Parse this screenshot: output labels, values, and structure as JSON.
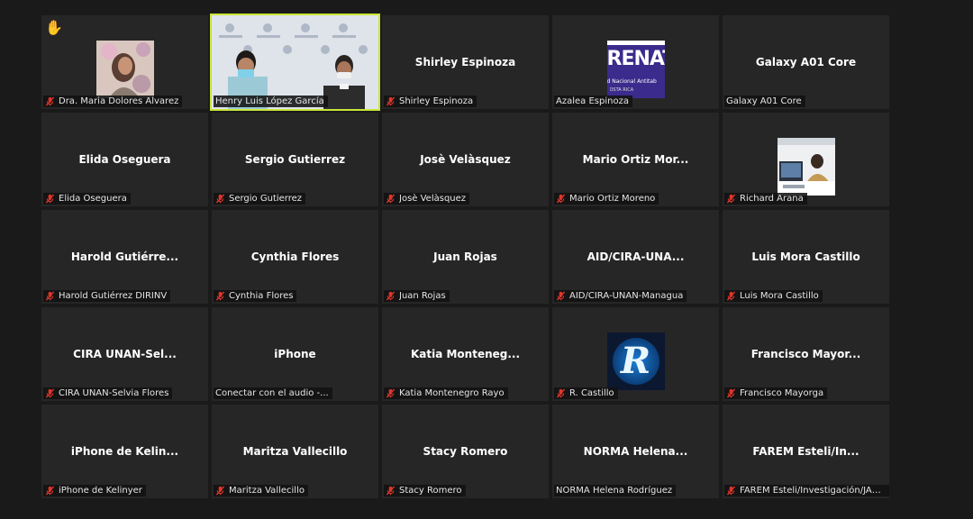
{
  "participants": [
    {
      "display": "Dra. Maria Dolores Alvarez",
      "label": "Dra. Maria Dolores Alvarez",
      "muted": true,
      "type": "photo-woman",
      "raised_hand": true
    },
    {
      "display": "Henry Luis López García",
      "label": "Henry Luis López García",
      "muted": false,
      "type": "video",
      "active_speaker": true
    },
    {
      "display": "Shirley Espinoza",
      "label": "Shirley Espinoza",
      "muted": true,
      "type": "name"
    },
    {
      "display": "Azalea Espinoza",
      "label": "Azalea Espinoza",
      "muted": false,
      "type": "logo-renata",
      "logo_text": "RENAT",
      "logo_sub": "d Nacional Antitab",
      "logo_sub2": "OSTA RICA"
    },
    {
      "display": "Galaxy A01 Core",
      "label": "Galaxy A01 Core",
      "muted": false,
      "type": "name"
    },
    {
      "display": "Elida Oseguera",
      "label": "Elida Oseguera",
      "muted": true,
      "type": "name"
    },
    {
      "display": "Sergio Gutierrez",
      "label": "Sergio Gutierrez",
      "muted": true,
      "type": "name"
    },
    {
      "display": "Josè Velàsquez",
      "label": "Josè Velàsquez",
      "muted": true,
      "type": "name"
    },
    {
      "display": "Mario  Ortiz  Mor...",
      "label": "Mario Ortiz Moreno",
      "muted": true,
      "type": "name"
    },
    {
      "display": "Richard Arana",
      "label": "Richard Arana",
      "muted": true,
      "type": "photo-desk"
    },
    {
      "display": "Harold  Gutiérre...",
      "label": "Harold Gutiérrez DIRINV",
      "muted": true,
      "type": "name"
    },
    {
      "display": "Cynthia Flores",
      "label": "Cynthia Flores",
      "muted": true,
      "type": "name"
    },
    {
      "display": "Juan Rojas",
      "label": "Juan Rojas",
      "muted": true,
      "type": "name"
    },
    {
      "display": "AID/CIRA-UNA...",
      "label": "AID/CIRA-UNAN-Managua",
      "muted": true,
      "type": "name"
    },
    {
      "display": "Luis Mora Castillo",
      "label": "Luis Mora Castillo",
      "muted": true,
      "type": "name"
    },
    {
      "display": "CIRA  UNAN-Sel...",
      "label": "CIRA UNAN-Selvia Flores",
      "muted": true,
      "type": "name"
    },
    {
      "display": "iPhone",
      "label": "Conectar con el audio -...",
      "muted": false,
      "type": "name"
    },
    {
      "display": "Katia  Monteneg...",
      "label": "Katia Montenegro Rayo",
      "muted": true,
      "type": "name"
    },
    {
      "display": "R. Castillo",
      "label": "R. Castillo",
      "muted": true,
      "type": "logo-r",
      "logo_letter": "R"
    },
    {
      "display": "Francisco  Mayor...",
      "label": "Francisco Mayorga",
      "muted": true,
      "type": "name"
    },
    {
      "display": "iPhone  de  Kelin...",
      "label": "iPhone de Kelinyer",
      "muted": true,
      "type": "name"
    },
    {
      "display": "Maritza Vallecillo",
      "label": "Maritza Vallecillo",
      "muted": true,
      "type": "name"
    },
    {
      "display": "Stacy Romero",
      "label": "Stacy Romero",
      "muted": true,
      "type": "name"
    },
    {
      "display": "NORMA  Helena...",
      "label": "NORMA Helena Rodríguez",
      "muted": false,
      "type": "name"
    },
    {
      "display": "FAREM  Esteli/In...",
      "label": "FAREM Esteli/Investigación/JABe...",
      "muted": true,
      "type": "name"
    }
  ],
  "icons": {
    "muted": "mic-muted-icon",
    "hand": "raised-hand-icon"
  },
  "colors": {
    "active_border": "#c8e63b",
    "mute_red": "#e0352b",
    "tile_bg": "#262626",
    "page_bg": "#1a1a1a"
  }
}
